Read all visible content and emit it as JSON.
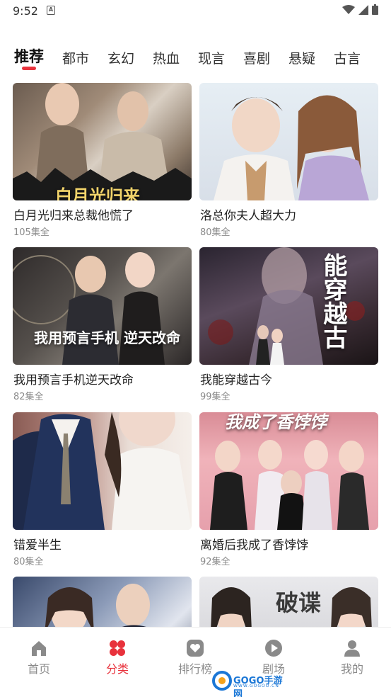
{
  "status_bar": {
    "time": "9:52",
    "notification_glyph": "A",
    "icons": [
      "wifi-icon",
      "signal-icon",
      "battery-icon"
    ]
  },
  "category_tabs": {
    "active_index": 0,
    "items": [
      "推荐",
      "都市",
      "玄幻",
      "热血",
      "现言",
      "喜剧",
      "悬疑",
      "古言"
    ]
  },
  "dramas": [
    {
      "title": "白月光归来总裁他慌了",
      "episodes": "105集全",
      "poster_text": "白月光归来"
    },
    {
      "title": "洛总你夫人超大力",
      "episodes": "80集全",
      "poster_text": ""
    },
    {
      "title": "我用预言手机逆天改命",
      "episodes": "82集全",
      "poster_text": "我用预言手机 逆天改命"
    },
    {
      "title": "我能穿越古今",
      "episodes": "99集全",
      "poster_text": "能穿越古"
    },
    {
      "title": "错爱半生",
      "episodes": "80集全",
      "poster_text": ""
    },
    {
      "title": "离婚后我成了香饽饽",
      "episodes": "92集全",
      "poster_text": "我成了香饽饽"
    },
    {
      "title": "",
      "episodes": "",
      "poster_text": ""
    },
    {
      "title": "",
      "episodes": "",
      "poster_text": "破谍"
    }
  ],
  "bottom_nav": {
    "active_index": 1,
    "items": [
      {
        "label": "首页",
        "icon": "home-icon"
      },
      {
        "label": "分类",
        "icon": "category-icon"
      },
      {
        "label": "排行榜",
        "icon": "ranking-icon"
      },
      {
        "label": "剧场",
        "icon": "play-icon"
      },
      {
        "label": "我的",
        "icon": "profile-icon"
      }
    ]
  },
  "watermark": {
    "text": "GOGO手游网",
    "subtext": "WWW.GOGOO.CN"
  },
  "colors": {
    "accent": "#e8323c",
    "inactive": "#8a8a8a",
    "background": "#ffffff"
  }
}
